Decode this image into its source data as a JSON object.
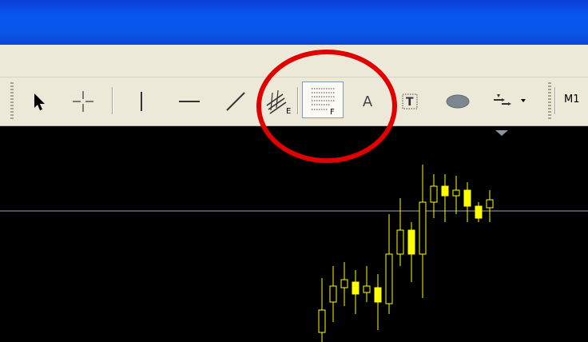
{
  "toolbar": {
    "tools": [
      {
        "name": "arrow-cursor-icon"
      },
      {
        "name": "crosshair-icon"
      },
      {
        "name": "vertical-line-icon"
      },
      {
        "name": "horizontal-line-icon"
      },
      {
        "name": "trendline-icon"
      },
      {
        "name": "equidistant-channel-icon"
      },
      {
        "name": "fibonacci-retracement-icon"
      },
      {
        "name": "text-icon",
        "label": "A"
      },
      {
        "name": "text-label-icon",
        "label": "T"
      },
      {
        "name": "ellipse-icon"
      },
      {
        "name": "arrows-dropdown-icon"
      }
    ],
    "channel_sub": "E",
    "fibo_sub": "F",
    "timeframe_label": "M1"
  },
  "chart": {
    "background": "#000000",
    "candle_color": "#ffff00",
    "hline_color": "#9aa6b4",
    "candles": [
      {
        "o": 12,
        "h": 80,
        "l": 0,
        "c": 40
      },
      {
        "o": 50,
        "h": 95,
        "l": 25,
        "c": 70
      },
      {
        "o": 68,
        "h": 100,
        "l": 45,
        "c": 78
      },
      {
        "o": 75,
        "h": 90,
        "l": 35,
        "c": 60
      },
      {
        "o": 62,
        "h": 95,
        "l": 50,
        "c": 70
      },
      {
        "o": 68,
        "h": 85,
        "l": 15,
        "c": 50
      },
      {
        "o": 48,
        "h": 160,
        "l": 35,
        "c": 110
      },
      {
        "o": 110,
        "h": 180,
        "l": 95,
        "c": 140
      },
      {
        "o": 140,
        "h": 150,
        "l": 75,
        "c": 110
      },
      {
        "o": 110,
        "h": 222,
        "l": 55,
        "c": 175
      },
      {
        "o": 175,
        "h": 210,
        "l": 155,
        "c": 195
      },
      {
        "o": 195,
        "h": 210,
        "l": 150,
        "c": 183
      },
      {
        "o": 183,
        "h": 208,
        "l": 160,
        "c": 190
      },
      {
        "o": 190,
        "h": 200,
        "l": 150,
        "c": 170
      },
      {
        "o": 170,
        "h": 175,
        "l": 150,
        "c": 155
      },
      {
        "o": 168,
        "h": 190,
        "l": 150,
        "c": 178
      }
    ]
  },
  "highlight": {
    "color": "#e00000"
  }
}
